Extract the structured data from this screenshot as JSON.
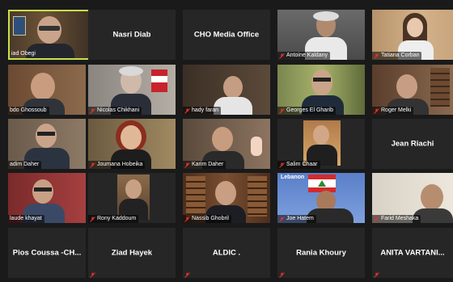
{
  "colors": {
    "background": "#1a1a1a",
    "tile": "#262626",
    "active_border": "#c8e24a",
    "muted_icon": "#e0322f"
  },
  "icons": {
    "muted": "mic-off-icon"
  },
  "participants": [
    {
      "name": "Ziad Obegi",
      "label": "iad Obegi",
      "video": true,
      "active": true
    },
    {
      "name": "Nasri Diab",
      "label": "Nasri Diab",
      "video": false
    },
    {
      "name": "CHO Media Office",
      "label": "CHO Media Office",
      "video": false
    },
    {
      "name": "Antoine Kaldany",
      "label": "Antoine Kaldany",
      "video": true
    },
    {
      "name": "Tatiana Corban",
      "label": "Tatiana Corban",
      "video": true
    },
    {
      "name": "Abdo Ghossoub",
      "label": "bdo Ghossoub",
      "video": true
    },
    {
      "name": "Nicolas Chikhani",
      "label": "Nicolas Chikhani",
      "video": true
    },
    {
      "name": "hady faran",
      "label": "hady faran",
      "video": true
    },
    {
      "name": "Georges El Gharib",
      "label": "Georges El Gharib",
      "video": true
    },
    {
      "name": "Roger Melki",
      "label": "Roger Melki",
      "video": true
    },
    {
      "name": "Nadim Daher",
      "label": "adim Daher",
      "video": true
    },
    {
      "name": "Joumana Hobeika",
      "label": "Joumana Hobeika",
      "video": true
    },
    {
      "name": "Karim Daher",
      "label": "Karim Daher",
      "video": true
    },
    {
      "name": "Salim Chaar",
      "label": "Salim Chaar",
      "video": true
    },
    {
      "name": "Jean Riachi",
      "label": "Jean Riachi",
      "video": false
    },
    {
      "name": "Claude khayat",
      "label": "laude khayat",
      "video": true
    },
    {
      "name": "Rony Kaddoum",
      "label": "Rony Kaddoum",
      "video": true
    },
    {
      "name": "Nassib Ghobril",
      "label": "Nassib Ghobril",
      "video": true
    },
    {
      "name": "Joe Hatem",
      "label": "Joe Hatem",
      "video": true,
      "sign": "Lebanon"
    },
    {
      "name": "Farid Meshaka",
      "label": "Farid Meshaka",
      "video": true
    },
    {
      "name": "Pios Coussa -CH...",
      "label": "Pios Coussa -CH...",
      "video": false
    },
    {
      "name": "Ziad Hayek",
      "label": "Ziad Hayek",
      "video": false
    },
    {
      "name": "ALDIC .",
      "label": "ALDIC .",
      "video": false
    },
    {
      "name": "Rania Khoury",
      "label": "Rania Khoury",
      "video": false
    },
    {
      "name": "ANITA VARTANI...",
      "label": "ANITA VARTANI...",
      "video": false
    }
  ]
}
